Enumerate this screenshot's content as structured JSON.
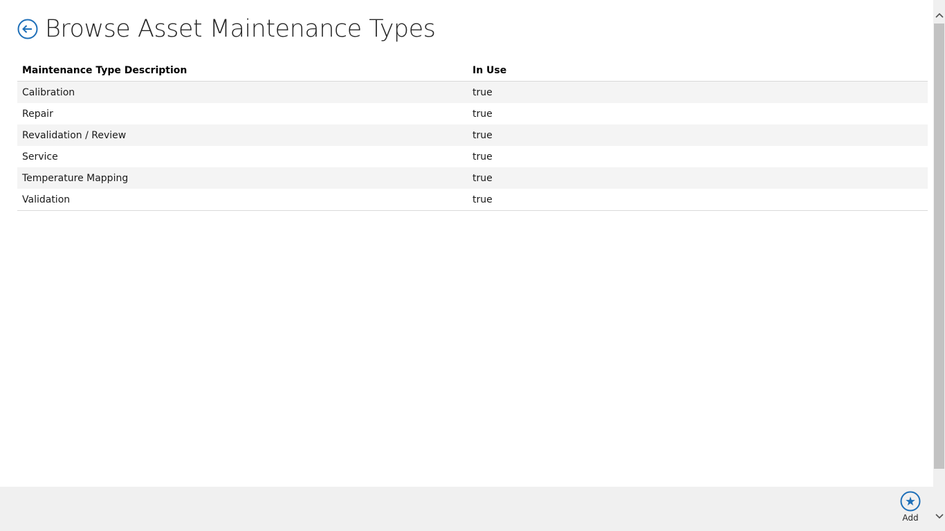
{
  "header": {
    "title": "Browse Asset Maintenance Types"
  },
  "grid": {
    "columns": [
      "Maintenance Type Description",
      "In Use"
    ],
    "rows": [
      {
        "description": "Calibration",
        "in_use": "true"
      },
      {
        "description": "Repair",
        "in_use": "true"
      },
      {
        "description": "Revalidation / Review",
        "in_use": "true"
      },
      {
        "description": "Service",
        "in_use": "true"
      },
      {
        "description": "Temperature Mapping",
        "in_use": "true"
      },
      {
        "description": "Validation",
        "in_use": "true"
      }
    ]
  },
  "appbar": {
    "add_label": "Add"
  },
  "icons": {
    "back": "back-arrow-icon",
    "add": "star-icon",
    "scroll_up": "chevron-up-icon",
    "scroll_down": "chevron-down-icon"
  },
  "colors": {
    "accent": "#1e6fb8",
    "appbar_bg": "#f0f0f0",
    "row_alt": "#f4f4f4"
  }
}
